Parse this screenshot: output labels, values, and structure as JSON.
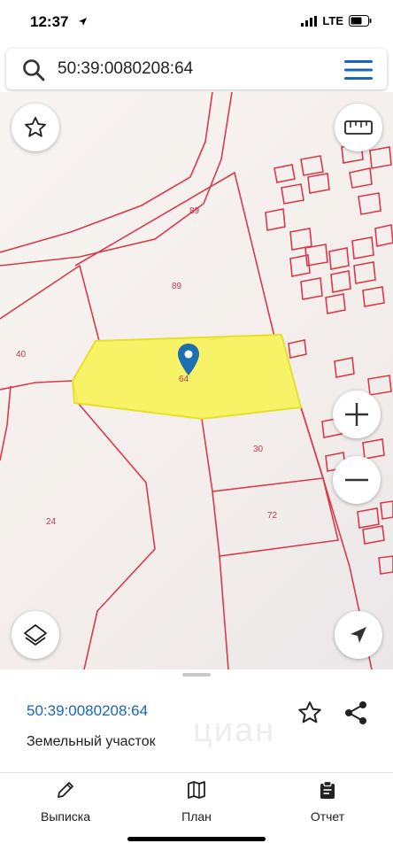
{
  "status": {
    "time": "12:37",
    "network": "LTE"
  },
  "search": {
    "value": "50:39:0080208:64"
  },
  "map": {
    "labels": {
      "p89_top": "89",
      "p89_mid": "89",
      "p40": "40",
      "p64": "64",
      "p30": "30",
      "p24": "24",
      "p72": "72"
    },
    "highlight_color": "#f7f25a",
    "boundary_color": "#d93a4a",
    "pin_color": "#1e6fb0"
  },
  "sheet": {
    "parcel_id": "50:39:0080208:64",
    "parcel_type": "Земельный участок",
    "watermark": "циан"
  },
  "tabs": [
    {
      "label": "Выписка",
      "icon": "pencil-icon"
    },
    {
      "label": "План",
      "icon": "map-icon"
    },
    {
      "label": "Отчет",
      "icon": "clipboard-icon"
    }
  ],
  "colors": {
    "accent": "#1a66b8"
  }
}
